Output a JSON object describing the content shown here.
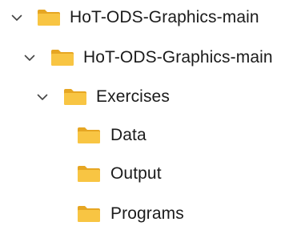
{
  "tree": {
    "items": [
      {
        "label": "HoT-ODS-Graphics-main",
        "expanded": true,
        "icon": "folder-icon",
        "expander": "chevron-down-icon"
      },
      {
        "label": "HoT-ODS-Graphics-main",
        "expanded": true,
        "icon": "folder-icon",
        "expander": "chevron-down-icon"
      },
      {
        "label": "Exercises",
        "expanded": true,
        "icon": "folder-icon",
        "expander": "chevron-down-icon"
      },
      {
        "label": "Data",
        "icon": "folder-icon"
      },
      {
        "label": "Output",
        "icon": "folder-icon"
      },
      {
        "label": "Programs",
        "icon": "folder-icon"
      }
    ]
  },
  "colors": {
    "folder_front": "#F8C543",
    "folder_back": "#E6A623",
    "chevron": "#444444",
    "text": "#1b1b1b"
  }
}
